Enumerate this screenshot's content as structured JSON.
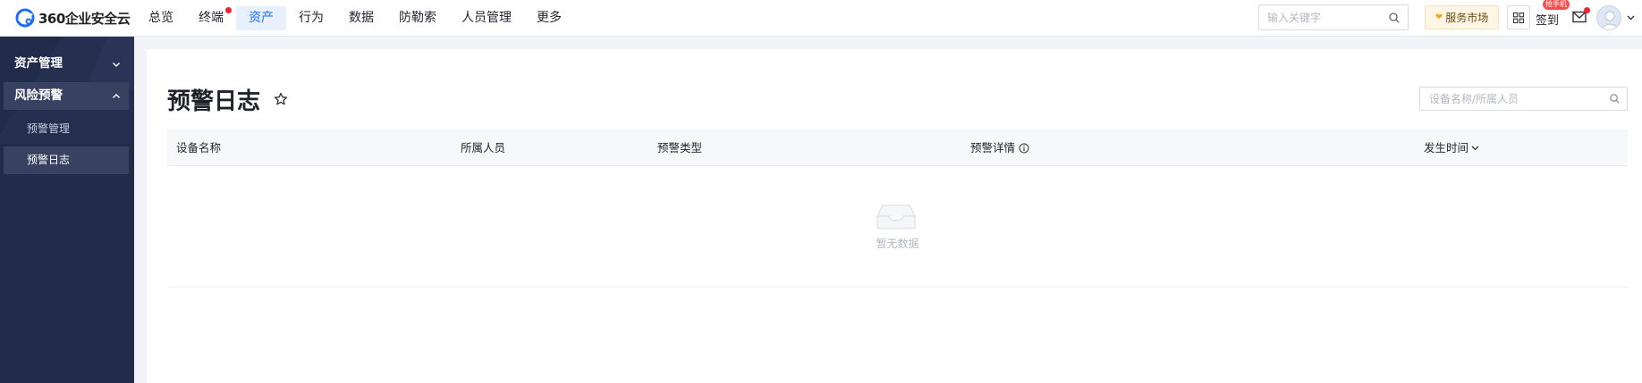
{
  "brand": {
    "name": "360企业安全云"
  },
  "nav": {
    "items": [
      {
        "label": "总览"
      },
      {
        "label": "终端"
      },
      {
        "label": "资产"
      },
      {
        "label": "行为"
      },
      {
        "label": "数据"
      },
      {
        "label": "防勒索"
      },
      {
        "label": "人员管理"
      },
      {
        "label": "更多"
      }
    ],
    "active": "资产",
    "dot_on": "终端"
  },
  "header": {
    "search_placeholder": "输入关键字",
    "market_label": "服务市场",
    "signin_label": "签到",
    "phone_badge": "抢手机"
  },
  "sidebar": {
    "groups": [
      {
        "label": "资产管理",
        "state": "collapsed"
      },
      {
        "label": "风险预警",
        "state": "expanded",
        "children": [
          {
            "label": "预警管理"
          },
          {
            "label": "预警日志",
            "active": true
          }
        ]
      }
    ]
  },
  "page": {
    "title": "预警日志",
    "filter_placeholder": "设备名称/所属人员",
    "columns": [
      {
        "label": "设备名称"
      },
      {
        "label": "所属人员"
      },
      {
        "label": "预警类型"
      },
      {
        "label": "预警详情",
        "icon": "info-icon"
      },
      {
        "label": "发生时间",
        "icon": "chevron-down-icon"
      }
    ],
    "rows": [],
    "empty_text": "暂无数据"
  },
  "colors": {
    "accent": "#1a6ef5",
    "sidebar_bg": "#232b4a",
    "sidebar_active": "#38415f",
    "badge_red": "#f5222d",
    "market_bg": "#fff6e5"
  }
}
